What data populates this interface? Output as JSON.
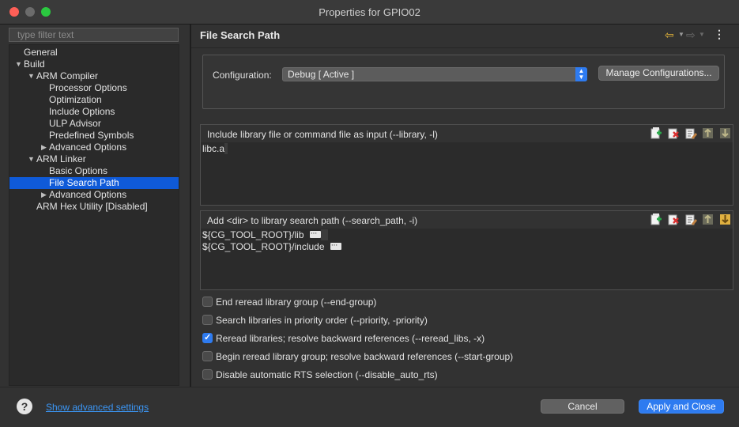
{
  "window": {
    "title": "Properties for GPIO02"
  },
  "sidebar": {
    "filter_placeholder": "type filter text",
    "items": [
      {
        "label": "General",
        "expander": ""
      },
      {
        "label": "Build",
        "expander": "▼"
      },
      {
        "label": "ARM Compiler",
        "expander": "▼"
      },
      {
        "label": "Processor Options",
        "expander": ""
      },
      {
        "label": "Optimization",
        "expander": ""
      },
      {
        "label": "Include Options",
        "expander": ""
      },
      {
        "label": "ULP Advisor",
        "expander": ""
      },
      {
        "label": "Predefined Symbols",
        "expander": ""
      },
      {
        "label": "Advanced Options",
        "expander": "▶"
      },
      {
        "label": "ARM Linker",
        "expander": "▼"
      },
      {
        "label": "Basic Options",
        "expander": ""
      },
      {
        "label": "File Search Path",
        "expander": "",
        "selected": true
      },
      {
        "label": "Advanced Options",
        "expander": "▶"
      },
      {
        "label": "ARM Hex Utility  [Disabled]",
        "expander": ""
      }
    ]
  },
  "page": {
    "title": "File Search Path",
    "configuration_label": "Configuration:",
    "configuration_value": "Debug  [ Active ]",
    "manage_button": "Manage Configurations...",
    "library_list": {
      "title": "Include library file or command file as input (--library, -l)",
      "entries": [
        "libc.a"
      ]
    },
    "search_path_list": {
      "title": "Add <dir> to library search path (--search_path, -i)",
      "entries": [
        "${CG_TOOL_ROOT}/lib",
        "${CG_TOOL_ROOT}/include"
      ]
    },
    "checkboxes": [
      {
        "label": "End reread library group (--end-group)",
        "checked": false
      },
      {
        "label": "Search libraries in priority order (--priority, -priority)",
        "checked": false
      },
      {
        "label": "Reread libraries; resolve backward references (--reread_libs, -x)",
        "checked": true
      },
      {
        "label": "Begin reread library group; resolve backward references (--start-group)",
        "checked": false
      },
      {
        "label": "Disable automatic RTS selection (--disable_auto_rts)",
        "checked": false
      }
    ]
  },
  "footer": {
    "help_glyph": "?",
    "advanced_link": "Show advanced settings",
    "cancel": "Cancel",
    "apply_close": "Apply and Close"
  },
  "colors": {
    "accent": "#2e7bf0",
    "selection": "#0f5ad8",
    "link": "#3b96f5"
  },
  "icons": [
    "add-icon",
    "delete-icon",
    "edit-icon",
    "move-up-icon",
    "move-down-icon"
  ]
}
